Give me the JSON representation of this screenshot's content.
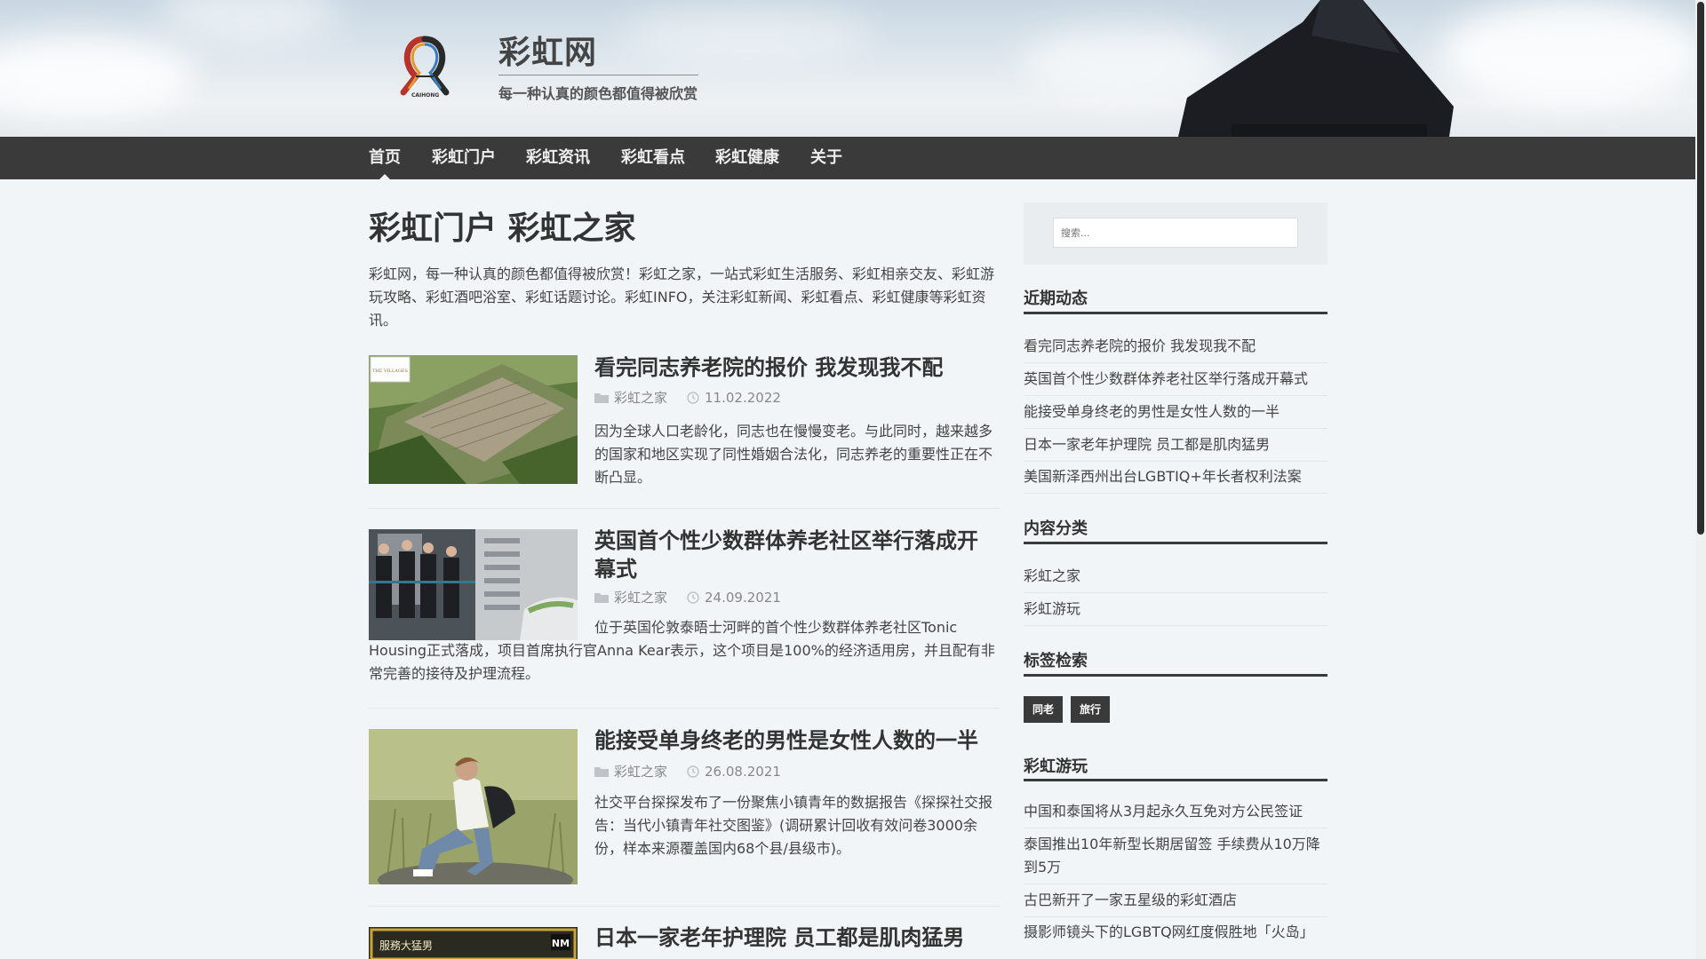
{
  "site": {
    "title": "彩虹网",
    "tagline": "每一种认真的颜色都值得被欣赏",
    "logo_text": "CAIHONG"
  },
  "nav": {
    "items": [
      {
        "label": "首页",
        "active": true
      },
      {
        "label": "彩虹门户"
      },
      {
        "label": "彩虹资讯"
      },
      {
        "label": "彩虹看点"
      },
      {
        "label": "彩虹健康"
      },
      {
        "label": "关于"
      }
    ]
  },
  "page": {
    "title": "彩虹门户 彩虹之家",
    "intro": "彩虹网，每一种认真的颜色都值得被欣赏！彩虹之家，一站式彩虹生活服务、彩虹相亲交友、彩虹游玩攻略、彩虹酒吧浴室、彩虹话题讨论。彩虹INFO，关注彩虹新闻、彩虹看点、彩虹健康等彩虹资讯。"
  },
  "posts": [
    {
      "title": "看完同志养老院的报价 我发现我不配",
      "category": "彩虹之家",
      "date": "11.02.2022",
      "excerpt": "因为全球人口老龄化，同志也在慢慢变老。与此同时，越来越多的国家和地区实现了同性婚姻合法化，同志养老的重要性正在不断凸显。",
      "thumb_label": "THE VILLAGES"
    },
    {
      "title": "英国首个性少数群体养老社区举行落成开幕式",
      "category": "彩虹之家",
      "date": "24.09.2021",
      "excerpt": "位于英国伦敦泰晤士河畔的首个性少数群体养老社区Tonic Housing正式落成，项目首席执行官Anna Kear表示，这个项目是100%的经济适用房，并且配有非常完善的接待及护理流程。"
    },
    {
      "title": "能接受单身终老的男性是女性人数的一半",
      "category": "彩虹之家",
      "date": "26.08.2021",
      "excerpt": "社交平台探探发布了一份聚焦小镇青年的数据报告《探探社交报告：当代小镇青年社交图鉴》(调研累计回收有效问卷3000余份，样本来源覆盖国内68个县/县级市)。"
    },
    {
      "title": "日本一家老年护理院 员工都是肌肉猛男",
      "thumb_label": "服務大猛男",
      "thumb_logo": "NM"
    }
  ],
  "sidebar": {
    "search_placeholder": "搜索...",
    "recent": {
      "title": "近期动态",
      "items": [
        "看完同志养老院的报价 我发现我不配",
        "英国首个性少数群体养老社区举行落成开幕式",
        "能接受单身终老的男性是女性人数的一半",
        "日本一家老年护理院 员工都是肌肉猛男",
        "美国新泽西州出台LGBTIQ+年长者权利法案"
      ]
    },
    "categories": {
      "title": "内容分类",
      "items": [
        "彩虹之家",
        "彩虹游玩"
      ]
    },
    "tags": {
      "title": "标签检索",
      "items": [
        "同老",
        "旅行"
      ]
    },
    "travel": {
      "title": "彩虹游玩",
      "items": [
        "中国和泰国将从3月起永久互免对方公民签证",
        "泰国推出10年新型长期居留签 手续费从10万降到5万",
        "古巴新开了一家五星级的彩虹酒店",
        "摄影师镜头下的LGBTQ网红度假胜地「火岛」"
      ]
    }
  }
}
